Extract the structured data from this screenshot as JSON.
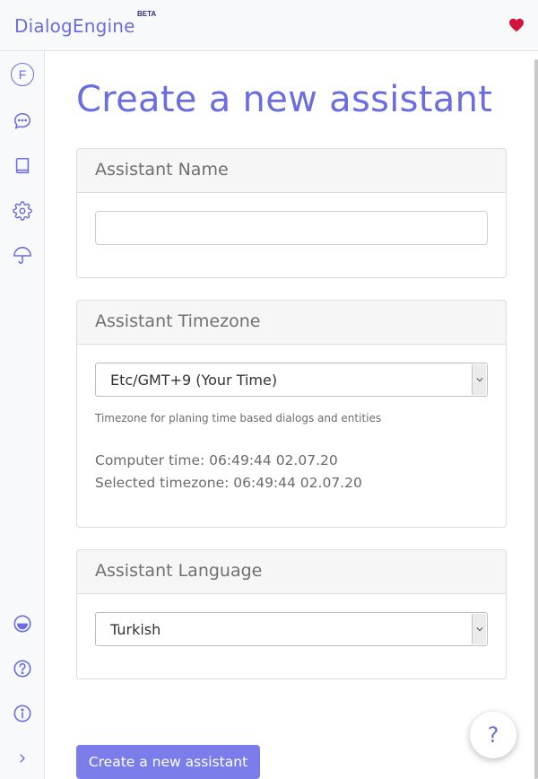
{
  "brand": {
    "name": "DialogEngine",
    "badge": "BETA"
  },
  "sidebar": {
    "avatar_initial": "F",
    "top_items": [
      {
        "name": "chat-icon"
      },
      {
        "name": "book-icon"
      },
      {
        "name": "gear-icon"
      },
      {
        "name": "umbrella-icon"
      }
    ],
    "bottom_items": [
      {
        "name": "smile-icon"
      },
      {
        "name": "help-circle-icon"
      },
      {
        "name": "info-icon"
      },
      {
        "name": "chevron-right-icon"
      }
    ]
  },
  "page": {
    "title": "Create a new assistant"
  },
  "name_card": {
    "title": "Assistant Name",
    "value": "",
    "placeholder": ""
  },
  "timezone_card": {
    "title": "Assistant Timezone",
    "selected": "Etc/GMT+9 (Your Time)",
    "hint": "Timezone for planing time based dialogs and entities",
    "computer_time": "Computer time: 06:49:44 02.07.20",
    "selected_time": "Selected timezone: 06:49:44 02.07.20"
  },
  "language_card": {
    "title": "Assistant Language",
    "selected": "Turkish"
  },
  "submit": {
    "label": "Create a new assistant"
  },
  "help_fab": {
    "label": "?"
  },
  "colors": {
    "accent": "#6b6ee0",
    "button": "#7b7eea",
    "heart": "#d6123c"
  }
}
